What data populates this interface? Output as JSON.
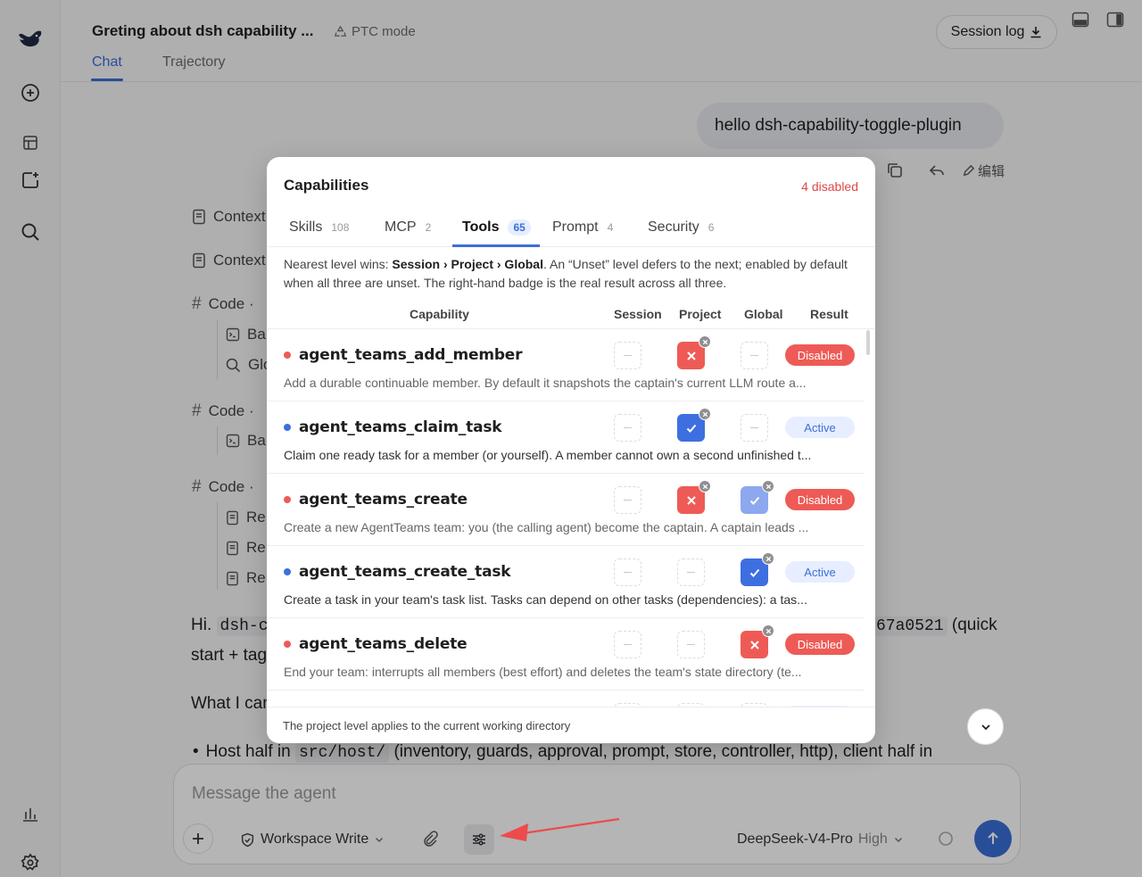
{
  "header": {
    "title": "Greting about dsh capability ...",
    "mode": "PTC mode",
    "tabs": [
      "Chat",
      "Trajectory"
    ],
    "session_log": "Session log"
  },
  "chat": {
    "user_message": "hello  dsh-capability-toggle-plugin",
    "edit_label": "编辑",
    "timeline": [
      {
        "label": "Context"
      },
      {
        "label": "Context"
      },
      {
        "label": "Code ·",
        "children": [
          "Ba",
          "Glo"
        ]
      },
      {
        "label": "Code ·",
        "children": [
          "Ba"
        ]
      },
      {
        "label": "Code ·",
        "children": [
          "Re",
          "Re",
          "Re"
        ]
      }
    ],
    "hi_prefix": "Hi.",
    "hi_code": "dsh-c",
    "hi_right_code": "67a0521",
    "hi_right_text": "(quick",
    "line2": "start + tag",
    "line3": "What I can",
    "bullet_prefix": "Host half in",
    "bullet_code": "src/host/",
    "bullet_rest": "(inventory, guards, approval, prompt, store, controller, http), client half in"
  },
  "modal": {
    "title": "Capabilities",
    "disabled_count": "4 disabled",
    "tabs": [
      {
        "label": "Skills",
        "count": "108"
      },
      {
        "label": "MCP",
        "count": "2"
      },
      {
        "label": "Tools",
        "count": "65"
      },
      {
        "label": "Prompt",
        "count": "4"
      },
      {
        "label": "Security",
        "count": "6"
      }
    ],
    "active_tab": "Tools",
    "note_parts": {
      "a": "Nearest level wins: ",
      "b": "Session › Project › Global",
      "c": ". An “Unset” level defers to the next; enabled by default when all three are unset. The right-hand badge is the real result across all three."
    },
    "columns": [
      "Capability",
      "Session",
      "Project",
      "Global",
      "Result"
    ],
    "rows": [
      {
        "name": "agent_teams_add_member",
        "desc": "Add a durable continuable member. By default it snapshots the captain's current LLM route a...",
        "session": "unset",
        "project": "off",
        "global": "unset",
        "result": "Disabled"
      },
      {
        "name": "agent_teams_claim_task",
        "desc": "Claim one ready task for a member (or yourself). A member cannot own a second unfinished t...",
        "session": "unset",
        "project": "on",
        "global": "unset",
        "result": "Active"
      },
      {
        "name": "agent_teams_create",
        "desc": "Create a new AgentTeams team: you (the calling agent) become the captain. A captain leads ...",
        "session": "unset",
        "project": "off",
        "global": "on",
        "result": "Disabled"
      },
      {
        "name": "agent_teams_create_task",
        "desc": "Create a task in your team's task list. Tasks can depend on other tasks (dependencies): a tas...",
        "session": "unset",
        "project": "unset",
        "global": "on",
        "result": "Active"
      },
      {
        "name": "agent_teams_delete",
        "desc": "End your team: interrupts all members (best effort) and deletes the team's state directory (te...",
        "session": "unset",
        "project": "unset",
        "global": "off",
        "result": "Disabled"
      }
    ],
    "footer": "The project level applies to the current working directory"
  },
  "composer": {
    "placeholder": "Message the agent",
    "workspace": "Workspace Write",
    "model": "DeepSeek-V4-Pro",
    "level": "High"
  },
  "colors": {
    "accent": "#3b6fd6",
    "disabled": "#ee5b56",
    "annotation_arrow": "#ee4b4b"
  }
}
